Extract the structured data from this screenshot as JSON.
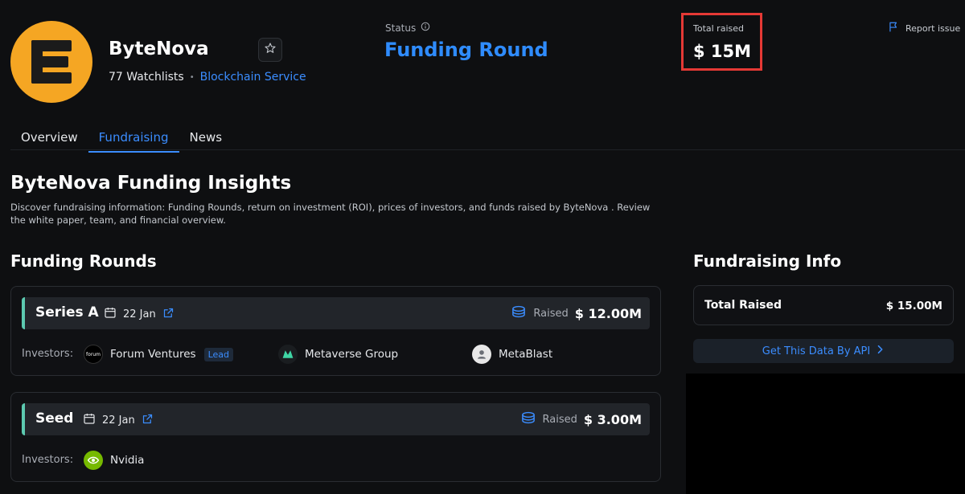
{
  "project": {
    "name": "ByteNova",
    "watchlists": "77 Watchlists",
    "category": "Blockchain Service",
    "logo_color": "#f5a623"
  },
  "status": {
    "label": "Status",
    "value": "Funding Round"
  },
  "total_raised_header": {
    "label": "Total raised",
    "value": "$ 15M"
  },
  "report_issue": "Report issue",
  "tabs": [
    {
      "label": "Overview",
      "active": false
    },
    {
      "label": "Fundraising",
      "active": true
    },
    {
      "label": "News",
      "active": false
    }
  ],
  "insights": {
    "title": "ByteNova Funding Insights",
    "description": "Discover fundraising information: Funding Rounds, return on investment (ROI), prices of investors, and funds raised by ByteNova . Review the white paper, team, and financial overview."
  },
  "funding_rounds": {
    "title": "Funding Rounds",
    "investors_label": "Investors:",
    "raised_label": "Raised",
    "rounds": [
      {
        "name": "Series A",
        "date": "22 Jan",
        "raised": "$ 12.00M",
        "investors": [
          {
            "name": "Forum Ventures",
            "lead": "Lead",
            "logo_text": "forum"
          },
          {
            "name": "Metaverse Group"
          },
          {
            "name": "MetaBlast"
          }
        ]
      },
      {
        "name": "Seed",
        "date": "22 Jan",
        "raised": "$ 3.00M",
        "investors": [
          {
            "name": "Nvidia"
          }
        ]
      }
    ]
  },
  "fundraising_info": {
    "title": "Fundraising Info",
    "total_label": "Total Raised",
    "total_value": "$ 15.00M",
    "api_button": "Get This Data By API"
  },
  "colors": {
    "accent": "#3b8dff",
    "round_marker": "#5cc9b0",
    "highlight_border": "#e53935"
  }
}
